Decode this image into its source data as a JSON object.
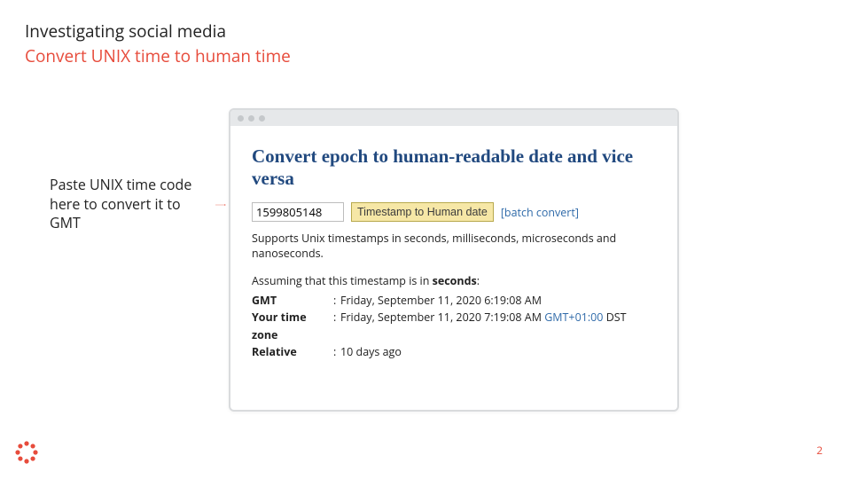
{
  "title": {
    "main": "Investigating social media",
    "sub": "Convert UNIX time to human time"
  },
  "callout": "Paste UNIX time code here to convert it to GMT",
  "window": {
    "heading": "Convert epoch to human-readable date and vice versa",
    "input_value": "1599805148",
    "button_label": "Timestamp to Human date",
    "batch_link": "[batch convert]",
    "supports_text": "Supports Unix timestamps in seconds, milliseconds, microseconds and nanoseconds.",
    "assuming_prefix": "Assuming that this timestamp is in ",
    "assuming_unit": "seconds",
    "assuming_suffix": ":",
    "rows": {
      "gmt_label": "GMT",
      "gmt_value": "Friday, September 11, 2020 6:19:08 AM",
      "ytz_label": "Your time zone",
      "ytz_value_pre": "Friday, September 11, 2020 7:19:08 AM ",
      "ytz_link": "GMT+01:00",
      "ytz_value_post": " DST",
      "rel_label": "Relative",
      "rel_value": "10 days ago"
    }
  },
  "page_number": "2"
}
